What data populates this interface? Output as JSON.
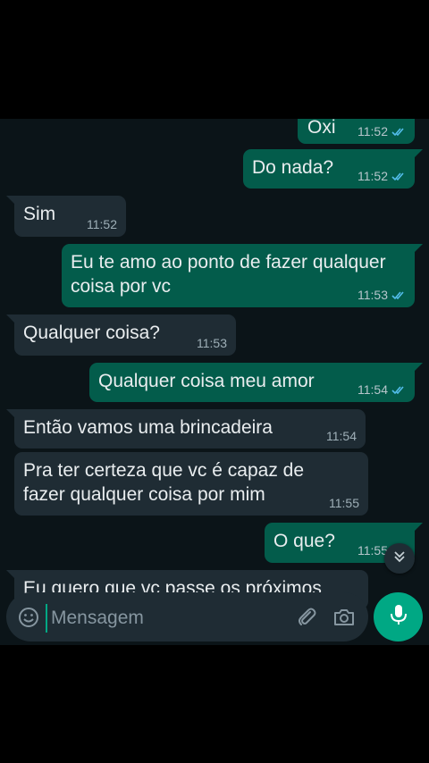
{
  "colors": {
    "outgoing_bubble": "#035c4b",
    "incoming_bubble": "#1f2c34",
    "chat_background": "#0b1418",
    "read_ticks": "#53bdeb",
    "accent": "#00a884"
  },
  "messages": [
    {
      "direction": "out",
      "text": "Oxi",
      "time": "11:52",
      "status": "read"
    },
    {
      "direction": "out",
      "text": "Do nada?",
      "time": "11:52",
      "status": "read"
    },
    {
      "direction": "in",
      "text": "Sim",
      "time": "11:52"
    },
    {
      "direction": "out",
      "text": "Eu te amo ao ponto de fazer qualquer\ncoisa por vc",
      "time": "11:53",
      "status": "read"
    },
    {
      "direction": "in",
      "text": "Qualquer coisa?",
      "time": "11:53"
    },
    {
      "direction": "out",
      "text": "Qualquer coisa meu amor",
      "time": "11:54",
      "status": "read"
    },
    {
      "direction": "in",
      "text": "Então vamos uma brincadeira",
      "time": "11:54"
    },
    {
      "direction": "in",
      "text": "Pra ter certeza que vc é capaz de\nfazer qualquer coisa por mim",
      "time": "11:55"
    },
    {
      "direction": "out",
      "text": "O que?",
      "time": "11:55",
      "status": "read"
    },
    {
      "direction": "in",
      "text": "Eu quero que vc passe os próximos",
      "time": ""
    }
  ],
  "composer": {
    "placeholder": "Mensagem",
    "value": ""
  },
  "icons": {
    "emoji": "emoji-icon",
    "attach": "paperclip-icon",
    "camera": "camera-icon",
    "mic": "microphone-icon",
    "scroll": "chevron-double-down-icon",
    "ticks": "double-check-icon"
  }
}
